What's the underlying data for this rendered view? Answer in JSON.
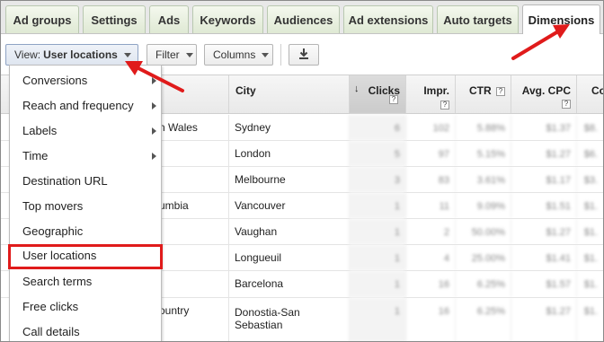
{
  "tabs": [
    {
      "label": "Ad groups"
    },
    {
      "label": "Settings"
    },
    {
      "label": "Ads"
    },
    {
      "label": "Keywords"
    },
    {
      "label": "Audiences"
    },
    {
      "label": "Ad extensions"
    },
    {
      "label": "Auto targets"
    },
    {
      "label": "Dimensions"
    }
  ],
  "toolbar": {
    "view_prefix": "View:",
    "view_value": "User locations",
    "filter_label": "Filter",
    "columns_label": "Columns",
    "download_icon": "download-icon"
  },
  "table": {
    "headers": {
      "city": "City",
      "clicks": "Clicks",
      "impr": "Impr.",
      "ctr": "CTR",
      "avg_cpc": "Avg. CPC",
      "cost_partial": "Co",
      "help_mark": "?"
    },
    "rows": [
      {
        "region_partial": "n Wales",
        "city": "Sydney",
        "clicks": "6",
        "impr": "102",
        "ctr": "5.88%",
        "cpc": "$1.37",
        "cost": "$8."
      },
      {
        "region_partial": "",
        "city": "London",
        "clicks": "5",
        "impr": "97",
        "ctr": "5.15%",
        "cpc": "$1.27",
        "cost": "$6."
      },
      {
        "region_partial": "",
        "city": "Melbourne",
        "clicks": "3",
        "impr": "83",
        "ctr": "3.61%",
        "cpc": "$1.17",
        "cost": "$3."
      },
      {
        "region_partial": "umbia",
        "city": "Vancouver",
        "clicks": "1",
        "impr": "11",
        "ctr": "9.09%",
        "cpc": "$1.51",
        "cost": "$1."
      },
      {
        "region_partial": "",
        "city": "Vaughan",
        "clicks": "1",
        "impr": "2",
        "ctr": "50.00%",
        "cpc": "$1.27",
        "cost": "$1."
      },
      {
        "region_partial": "",
        "city": "Longueuil",
        "clicks": "1",
        "impr": "4",
        "ctr": "25.00%",
        "cpc": "$1.41",
        "cost": "$1."
      },
      {
        "region_partial": "",
        "city": "Barcelona",
        "clicks": "1",
        "impr": "16",
        "ctr": "6.25%",
        "cpc": "$1.57",
        "cost": "$1."
      },
      {
        "region_partial": "ountry",
        "city": "Donostia-San Sebastian",
        "clicks": "1",
        "impr": "16",
        "ctr": "6.25%",
        "cpc": "$1.27",
        "cost": "$1."
      }
    ]
  },
  "menu": {
    "items": [
      {
        "label": "Conversions",
        "submenu": true
      },
      {
        "label": "Reach and frequency",
        "submenu": true
      },
      {
        "label": "Labels",
        "submenu": true
      },
      {
        "label": "Time",
        "submenu": true
      },
      {
        "label": "Destination URL",
        "submenu": false
      },
      {
        "label": "Top movers",
        "submenu": false
      },
      {
        "label": "Geographic",
        "submenu": false
      },
      {
        "label": "User locations",
        "submenu": false,
        "selected": true
      },
      {
        "label": "Search terms",
        "submenu": false
      },
      {
        "label": "Free clicks",
        "submenu": false
      },
      {
        "label": "Call details",
        "submenu": false
      }
    ]
  },
  "colors": {
    "annotation_red": "#e01b1b",
    "tab_green": "#dfe9d4"
  }
}
